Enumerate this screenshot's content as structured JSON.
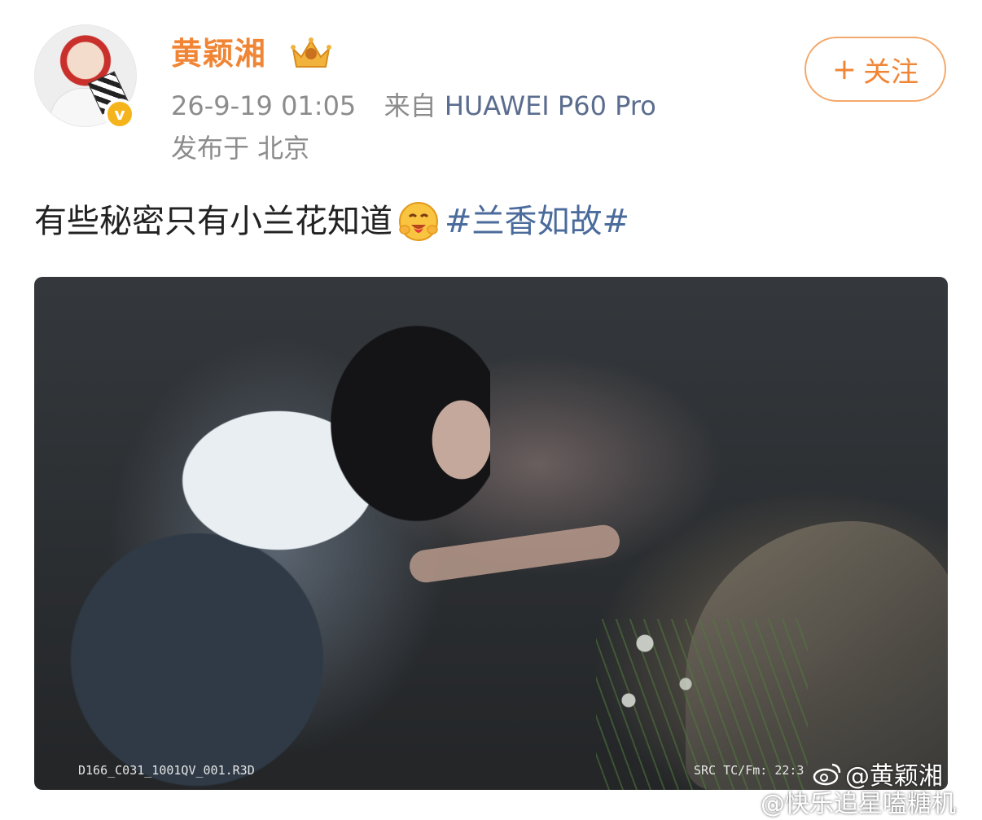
{
  "header": {
    "username": "黄颖湘",
    "post_time": "26-9-19 01:05",
    "source_prefix": "来自",
    "device": "HUAWEI P60 Pro",
    "location": "发布于 北京",
    "follow_label": "关注",
    "follow_plus": "+",
    "verified_badge": "v"
  },
  "post": {
    "text": "有些秘密只有小兰花知道",
    "emoji": "hugging-face-emoji",
    "hashtag": "#兰香如故#"
  },
  "photo": {
    "clip_name": "D166_C031_1001QV_001.R3D",
    "timecode": "SRC TC/Fm: 22:3",
    "watermark_1": "@黄颖湘",
    "watermark_2": "@快乐追星嗑糖机"
  },
  "colors": {
    "username": "#f08535",
    "hashtag": "#4a6b9b",
    "meta": "#8c8c8c",
    "follow_border": "#f4a86b",
    "verified": "#f6b41c"
  }
}
